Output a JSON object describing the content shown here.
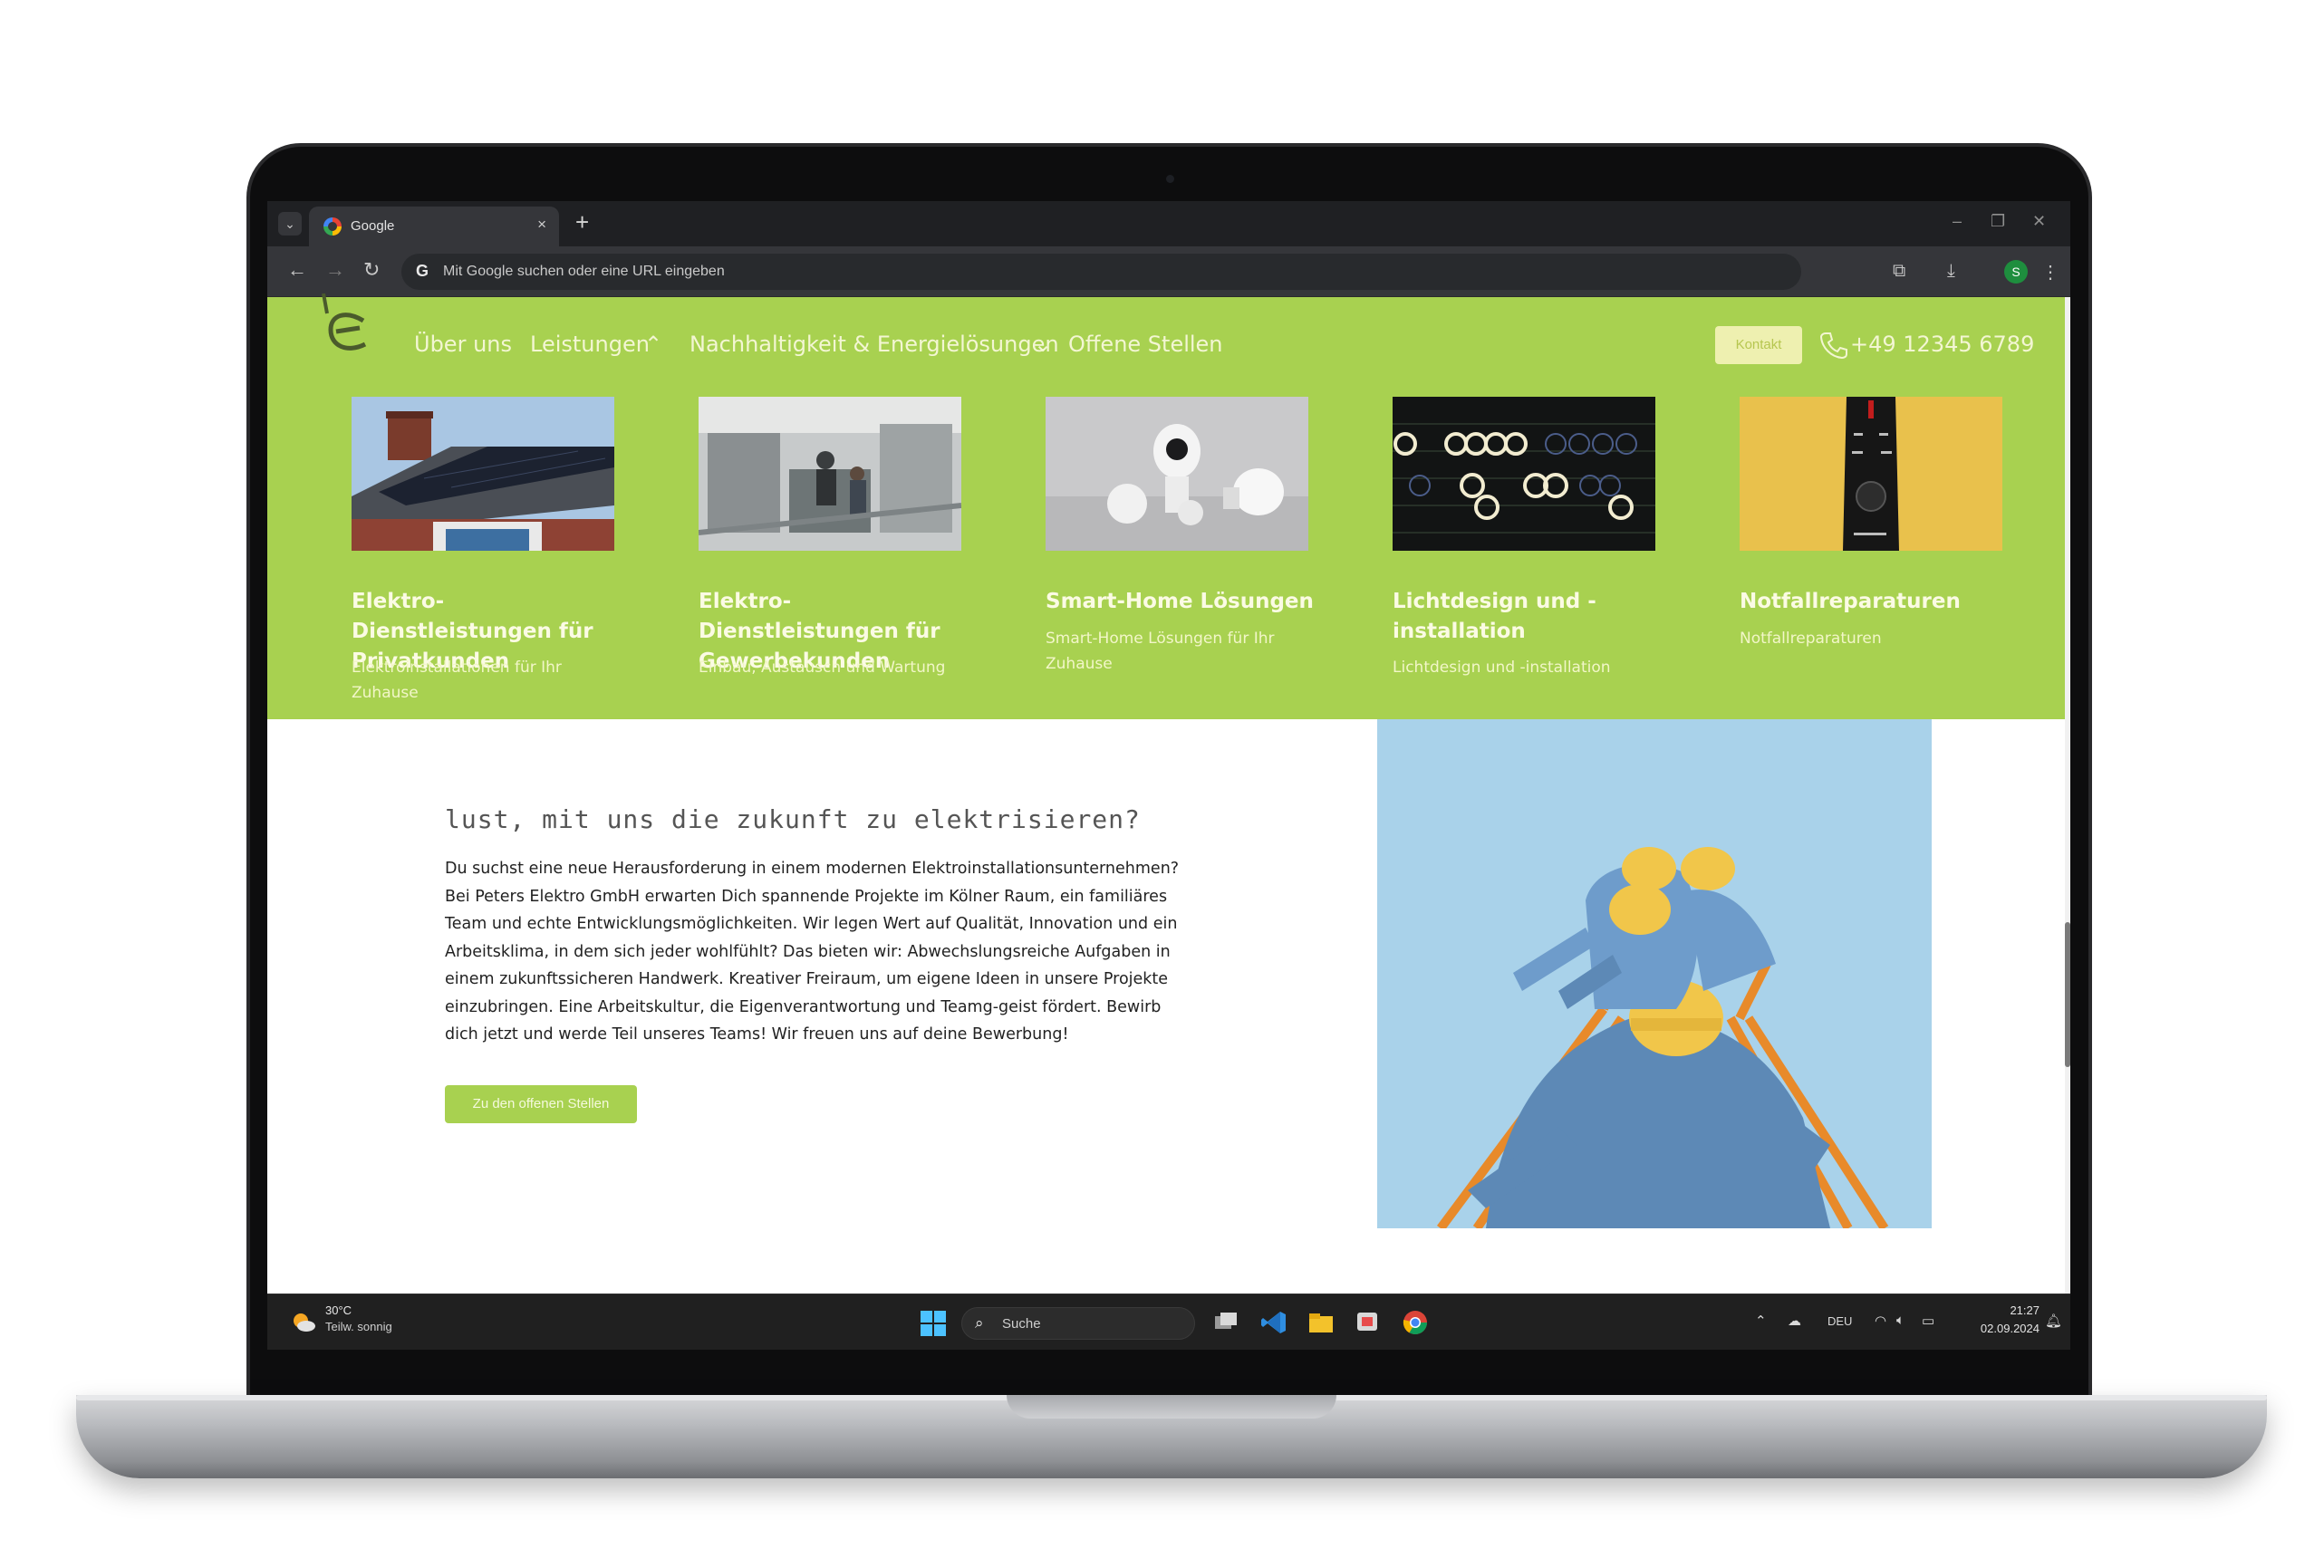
{
  "browser": {
    "tab_title": "Google",
    "tab_close": "×",
    "new_tab": "+",
    "omnibox_placeholder": "Mit Google suchen oder eine URL eingeben",
    "profile_initial": "S"
  },
  "site": {
    "nav": {
      "about": "Über uns",
      "services": "Leistungen",
      "sustainability": "Nachhaltigkeit & Energielösungen",
      "jobs": "Offene Stellen",
      "contact_button": "Kontakt",
      "phone": "+49 12345 6789"
    },
    "services": [
      {
        "title": "Elektro-Dienstleistungen für Privatkunden",
        "subtitle": "Elektroinstallationen für Ihr Zuhause"
      },
      {
        "title": "Elektro-Dienstleistungen für Gewerbekunden",
        "subtitle": "Einbau, Austausch und Wartung"
      },
      {
        "title": "Smart-Home Lösungen",
        "subtitle": "Smart-Home Lösungen für Ihr Zuhause"
      },
      {
        "title": "Lichtdesign und -installation",
        "subtitle": "Lichtdesign und -installation"
      },
      {
        "title": "Notfallreparaturen",
        "subtitle": "Notfallreparaturen"
      }
    ],
    "jobs_section": {
      "heading": "Lust, mit uns die Zukunft zu elektrisieren?",
      "text": "Du suchst eine neue Herausforderung in einem modernen Elektroinstallationsunternehmen? Bei Peters Elektro GmbH erwarten Dich spannende Projekte im Kölner Raum, ein familiäres Team und echte Entwicklungsmöglichkeiten. Wir legen Wert auf Qualität, Innovation und ein Arbeitsklima, in dem sich jeder wohlfühlt? Das bieten wir: Abwechslungsreiche Aufgaben in einem zukunftssicheren Handwerk. Kreativer Freiraum, um eigene Ideen in unsere Projekte einzubringen. Eine Arbeitskultur, die Eigenverantwortung und Teamg-geist fördert. Bewirb dich jetzt und werde Teil unseres Teams! Wir freuen uns auf deine Bewerbung!",
      "button": "Zu den offenen Stellen"
    }
  },
  "taskbar": {
    "weather_temp": "30°C",
    "weather_desc": "Teilw. sonnig",
    "search_label": "Suche",
    "language": "DEU",
    "time": "21:27",
    "date": "02.09.2024"
  },
  "colors": {
    "brand_green": "#a8d150",
    "chrome_dark": "#35363a",
    "taskbar": "#202020"
  },
  "icons": [
    "chevron-down-icon",
    "google-icon",
    "back-arrow-icon",
    "forward-arrow-icon",
    "reload-icon",
    "extensions-icon",
    "download-icon",
    "menu-dots-icon",
    "phone-icon",
    "windows-start-icon",
    "search-icon",
    "weather-icon",
    "wifi-icon",
    "volume-icon",
    "battery-icon",
    "bell-icon"
  ]
}
